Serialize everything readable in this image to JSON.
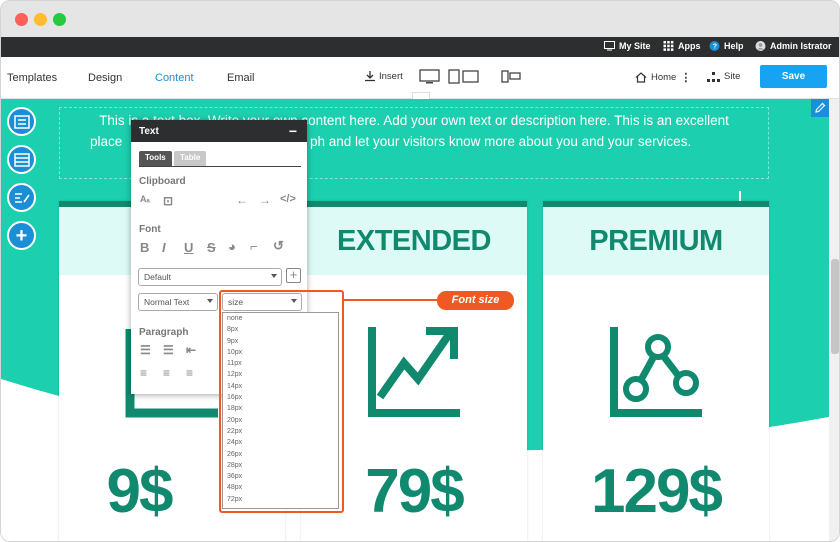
{
  "topbar": {
    "my_site": "My Site",
    "apps": "Apps",
    "help": "Help",
    "user": "Admin Istrator"
  },
  "nav": {
    "tabs": [
      "Templates",
      "Design",
      "Content",
      "Email"
    ],
    "active_tab": "Content",
    "insert": "Insert",
    "home": "Home",
    "site": "Site",
    "save": "Save"
  },
  "textbox": {
    "line1": "This is a text box. Write your own content here. Add your own text or description here. This is an excellent",
    "line2_left": "place",
    "line2_right": "ph and let your visitors know more about you and your services."
  },
  "cards": [
    {
      "title": "",
      "price": "",
      "icon": "bar-chart-icon"
    },
    {
      "title": "EXTENDED",
      "price": "79$",
      "icon": "trending-up-icon"
    },
    {
      "title": "PREMIUM",
      "price": "129$",
      "icon": "network-chart-icon"
    }
  ],
  "behind_card": {
    "price": "9$"
  },
  "panel": {
    "title": "Text",
    "tabs": [
      "Tools",
      "Table"
    ],
    "clipboard_label": "Clipboard",
    "font_label": "Font",
    "font_family_value": "Default",
    "style_value": "Normal Text",
    "size_value": "size",
    "paragraph_label": "Paragraph"
  },
  "size_options": [
    "none",
    "8px",
    "9px",
    "10px",
    "11px",
    "12px",
    "14px",
    "16px",
    "18px",
    "20px",
    "22px",
    "24px",
    "26px",
    "28px",
    "36px",
    "48px",
    "72px"
  ],
  "callout": {
    "label": "Font size"
  },
  "colors": {
    "teal": "#1ccfae",
    "dark_teal": "#10896f",
    "accent_blue": "#1a8fd6",
    "callout_orange": "#f05a22"
  }
}
